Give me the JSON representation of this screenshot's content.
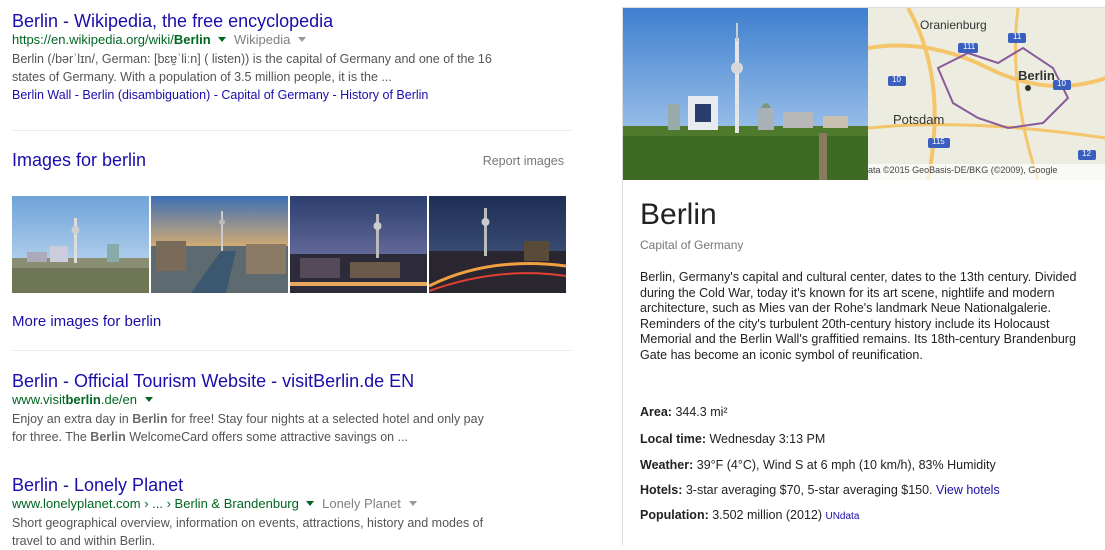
{
  "result1": {
    "title": "Berlin - Wikipedia, the free encyclopedia",
    "url_prefix": "https://en.wikipedia.org/wiki/",
    "url_bold": "Berlin",
    "source": "Wikipedia",
    "snippet_line1": "Berlin (/bərˈlɪn/, German: [bɛɐ̯ˈliːn] ( listen)) is the capital of Germany and one of the 16",
    "snippet_line2": "states of Germany. With a population of 3.5 million people, it is the ...",
    "sitelinks": [
      "Berlin Wall",
      "Berlin (disambiguation)",
      "Capital of Germany",
      "History of Berlin"
    ],
    "sitelink_sep": " - "
  },
  "images": {
    "title": "Images for berlin",
    "report": "Report images",
    "more": "More images for berlin"
  },
  "result2": {
    "title": "Berlin - Official Tourism Website - visitBerlin.de EN",
    "url_prefix": "www.visit",
    "url_bold": "berlin",
    "url_suffix": ".de/en",
    "snippet_a": "Enjoy an extra day in ",
    "snippet_b": "Berlin",
    "snippet_c": " for free! Stay four nights at a selected hotel and only pay",
    "snippet_d": "for three. The ",
    "snippet_e": "Berlin",
    "snippet_f": " WelcomeCard offers some attractive savings on ..."
  },
  "result3": {
    "title": "Berlin - Lonely Planet",
    "url": "www.lonelyplanet.com › ... › Berlin & Brandenburg",
    "source": "Lonely Planet",
    "snippet_line1": "Short geographical overview, information on events, attractions, history and modes of",
    "snippet_line2": "travel to and within Berlin."
  },
  "map": {
    "labels": [
      "Oranienburg",
      "Berlin",
      "Potsdam"
    ],
    "road_numbers": [
      "111",
      "11",
      "10",
      "10",
      "115",
      "12"
    ],
    "copyright": "ata ©2015 GeoBasis-DE/BKG (©2009), Google"
  },
  "knowledge_panel": {
    "title": "Berlin",
    "subtitle": "Capital of Germany",
    "description": "Berlin, Germany's capital and cultural center, dates to the 13th century. Divided during the Cold War, today it's known for its art scene, nightlife and modern architecture, such as Mies van der Rohe's landmark Neue Nationalgalerie. Reminders of the city's turbulent 20th-century history include its Holocaust Memorial and the Berlin Wall's graffitied remains. Its 18th-century Brandenburg Gate has become an iconic symbol of reunification.",
    "facts": {
      "area_label": "Area:",
      "area_value": " 344.3 mi²",
      "time_label": "Local time:",
      "time_value": " Wednesday 3:13 PM",
      "weather_label": "Weather:",
      "weather_value": " 39°F (4°C), Wind S at 6 mph (10 km/h), 83% Humidity",
      "hotels_label": "Hotels:",
      "hotels_value": " 3-star averaging $70, 5-star averaging $150. ",
      "hotels_link": "View hotels",
      "population_label": "Population:",
      "population_value": " 3.502 million (2012) ",
      "population_source": "UNdata"
    }
  },
  "colors": {
    "link": "#1a0dab",
    "url": "#006621",
    "snippet": "#545454"
  }
}
